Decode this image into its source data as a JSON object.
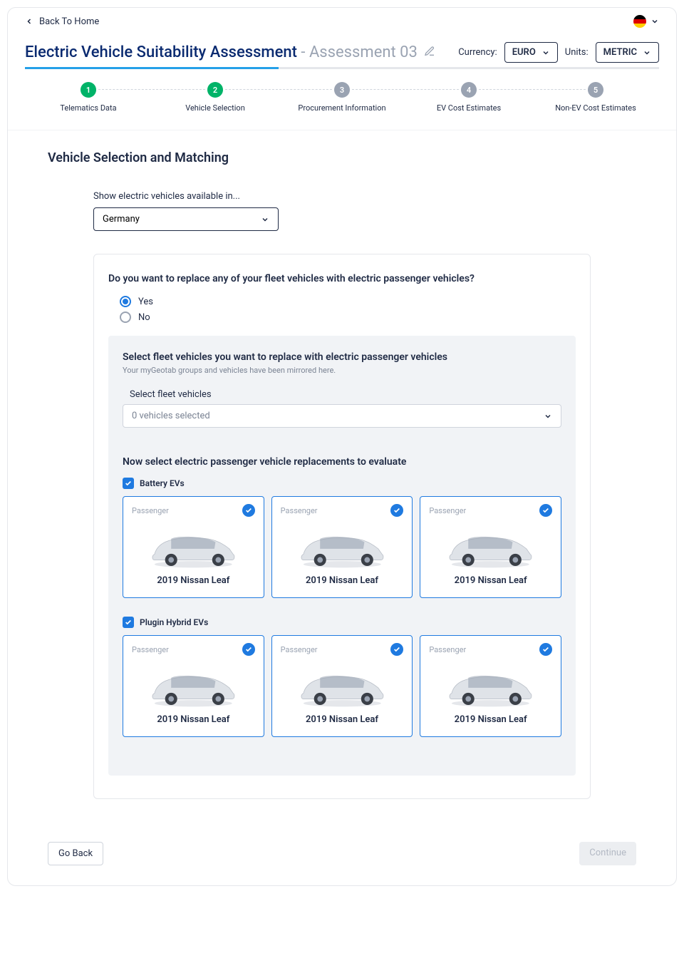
{
  "back_label": "Back To Home",
  "title_primary": "Electric Vehicle Suitability Assessment",
  "title_suffix": "- Assessment 03",
  "currency": {
    "label": "Currency:",
    "value": "EURO"
  },
  "units": {
    "label": "Units:",
    "value": "METRIC"
  },
  "steps": [
    {
      "num": "1",
      "label": "Telematics Data",
      "state": "done"
    },
    {
      "num": "2",
      "label": "Vehicle Selection",
      "state": "done"
    },
    {
      "num": "3",
      "label": "Procurement Information",
      "state": "pending"
    },
    {
      "num": "4",
      "label": "EV Cost Estimates",
      "state": "pending"
    },
    {
      "num": "5",
      "label": "Non-EV Cost Estimates",
      "state": "pending"
    }
  ],
  "section_title": "Vehicle Selection and Matching",
  "avail_label": "Show electric vehicles available in...",
  "avail_value": "Germany",
  "question": "Do you want to replace any of your fleet vehicles with electric passenger vehicles?",
  "radios": {
    "yes": "Yes",
    "no": "No",
    "selected": "yes"
  },
  "select_heading": "Select fleet vehicles you want to replace with electric passenger vehicles",
  "select_note": "Your myGeotab groups and vehicles have been mirrored here.",
  "sf_label": "Select fleet vehicles",
  "sf_value": "0 vehicles selected",
  "eval_heading": "Now select electric passenger vehicle replacements to evaluate",
  "categories": [
    {
      "checked": true,
      "label": "Battery EVs",
      "cards": [
        {
          "tag": "Passenger",
          "name": "2019 Nissan Leaf",
          "checked": true
        },
        {
          "tag": "Passenger",
          "name": "2019 Nissan Leaf",
          "checked": true
        },
        {
          "tag": "Passenger",
          "name": "2019 Nissan Leaf",
          "checked": true
        }
      ]
    },
    {
      "checked": true,
      "label": "Plugin Hybrid EVs",
      "cards": [
        {
          "tag": "Passenger",
          "name": "2019 Nissan Leaf",
          "checked": true
        },
        {
          "tag": "Passenger",
          "name": "2019 Nissan Leaf",
          "checked": true
        },
        {
          "tag": "Passenger",
          "name": "2019 Nissan Leaf",
          "checked": true
        }
      ]
    }
  ],
  "go_back": "Go Back",
  "continue": "Continue"
}
